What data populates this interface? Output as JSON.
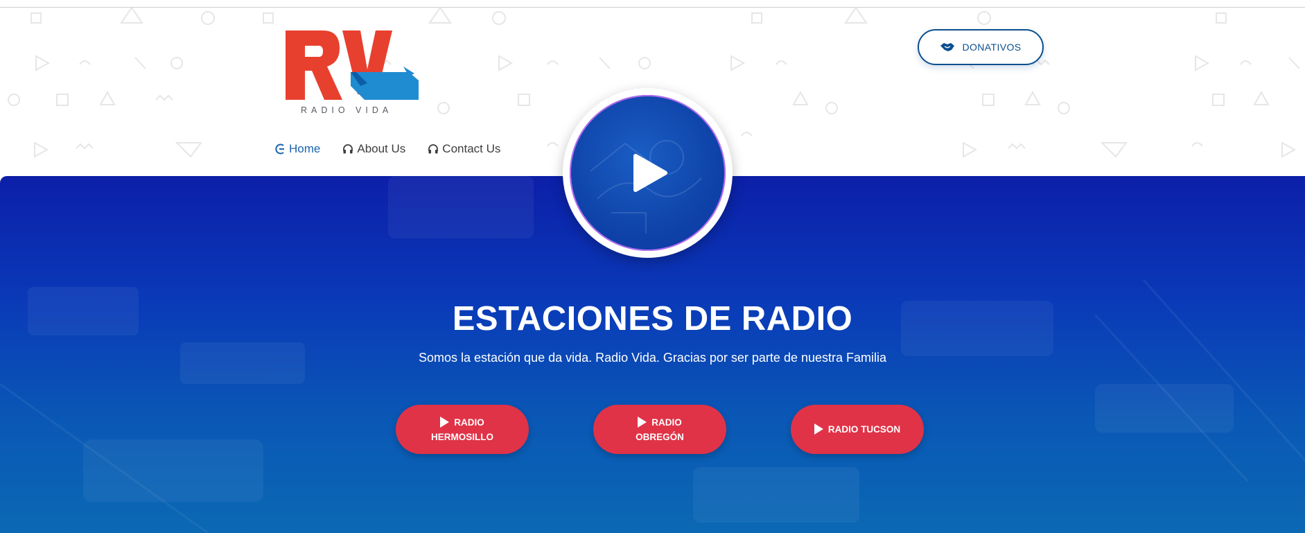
{
  "brand": {
    "logo_text": "RADIO VIDA",
    "colors": {
      "red": "#e8402e",
      "blue": "#1f8bd1",
      "navy": "#0a4e8f",
      "button_red": "#e03347"
    }
  },
  "header": {
    "donate_label": "DONATIVOS",
    "donate_icon": "handshake-icon"
  },
  "nav": {
    "items": [
      {
        "label": "Home",
        "icon": "home-icon",
        "active": true
      },
      {
        "label": "About Us",
        "icon": "headphones-icon",
        "active": false
      },
      {
        "label": "Contact Us",
        "icon": "headphones-icon",
        "active": false
      }
    ]
  },
  "player": {
    "icon": "play-icon"
  },
  "hero": {
    "title": "ESTACIONES DE RADIO",
    "subtitle": "Somos la estación que da vida. Radio Vida. Gracias por ser parte de nuestra Familia",
    "stations": [
      {
        "line1": "RADIO",
        "line2": "HERMOSILLO"
      },
      {
        "line1": "RADIO",
        "line2": "OBREGÓN"
      },
      {
        "line1": "RADIO TUCSON",
        "line2": ""
      }
    ]
  }
}
